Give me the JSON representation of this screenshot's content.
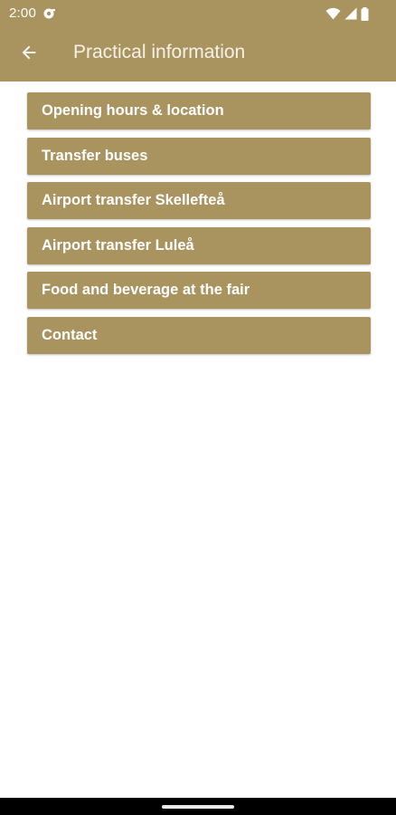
{
  "status_bar": {
    "time": "2:00",
    "icons": [
      "notification-icon",
      "wifi-icon",
      "signal-icon",
      "battery-icon"
    ]
  },
  "app_bar": {
    "title": "Practical information",
    "back_icon": "arrow-left-icon"
  },
  "menu": {
    "items": [
      {
        "label": "Opening hours & location"
      },
      {
        "label": "Transfer buses"
      },
      {
        "label": "Airport transfer Skellefteå"
      },
      {
        "label": "Airport transfer Luleå"
      },
      {
        "label": "Food and beverage at the fair"
      },
      {
        "label": "Contact"
      }
    ]
  },
  "colors": {
    "accent": "#a99460",
    "text_on_accent": "#ffffff",
    "background": "#ffffff",
    "nav_bar": "#000000"
  }
}
